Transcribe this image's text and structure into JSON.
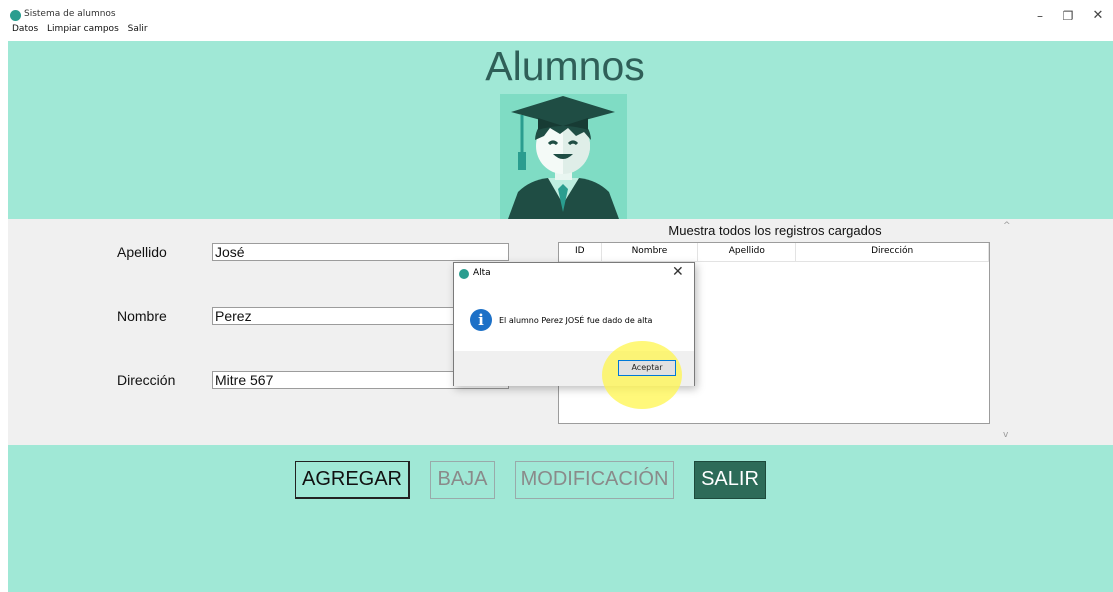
{
  "window": {
    "title": "Sistema de alumnos",
    "controls": {
      "minimize": "–",
      "restore": "❐",
      "close": "✕"
    }
  },
  "menu": [
    "Datos",
    "Limpiar campos",
    "Salir"
  ],
  "header": {
    "title": "Alumnos",
    "icon": "graduate-student-icon"
  },
  "form": {
    "apellido_label": "Apellido",
    "apellido_value": "José",
    "nombre_label": "Nombre",
    "nombre_value": "Perez",
    "direccion_label": "Dirección",
    "direccion_value": "Mitre 567"
  },
  "table": {
    "caption": "Muestra todos los registros cargados",
    "columns": [
      "ID",
      "Nombre",
      "Apellido",
      "Dirección"
    ],
    "rows": []
  },
  "buttons": {
    "agregar": "AGREGAR",
    "baja": "BAJA",
    "modificacion": "MODIFICACIÓN",
    "salir": "SALIR"
  },
  "dialog": {
    "title": "Alta",
    "message": "El alumno Perez JOSÉ fue dado de alta",
    "ok_label": "Aceptar",
    "close": "✕",
    "info_glyph": "i"
  },
  "colors": {
    "panel": "#a0e8d6",
    "title_text": "#2f5f58",
    "salir_button": "#2d6b58",
    "highlight": "#fff64d"
  }
}
